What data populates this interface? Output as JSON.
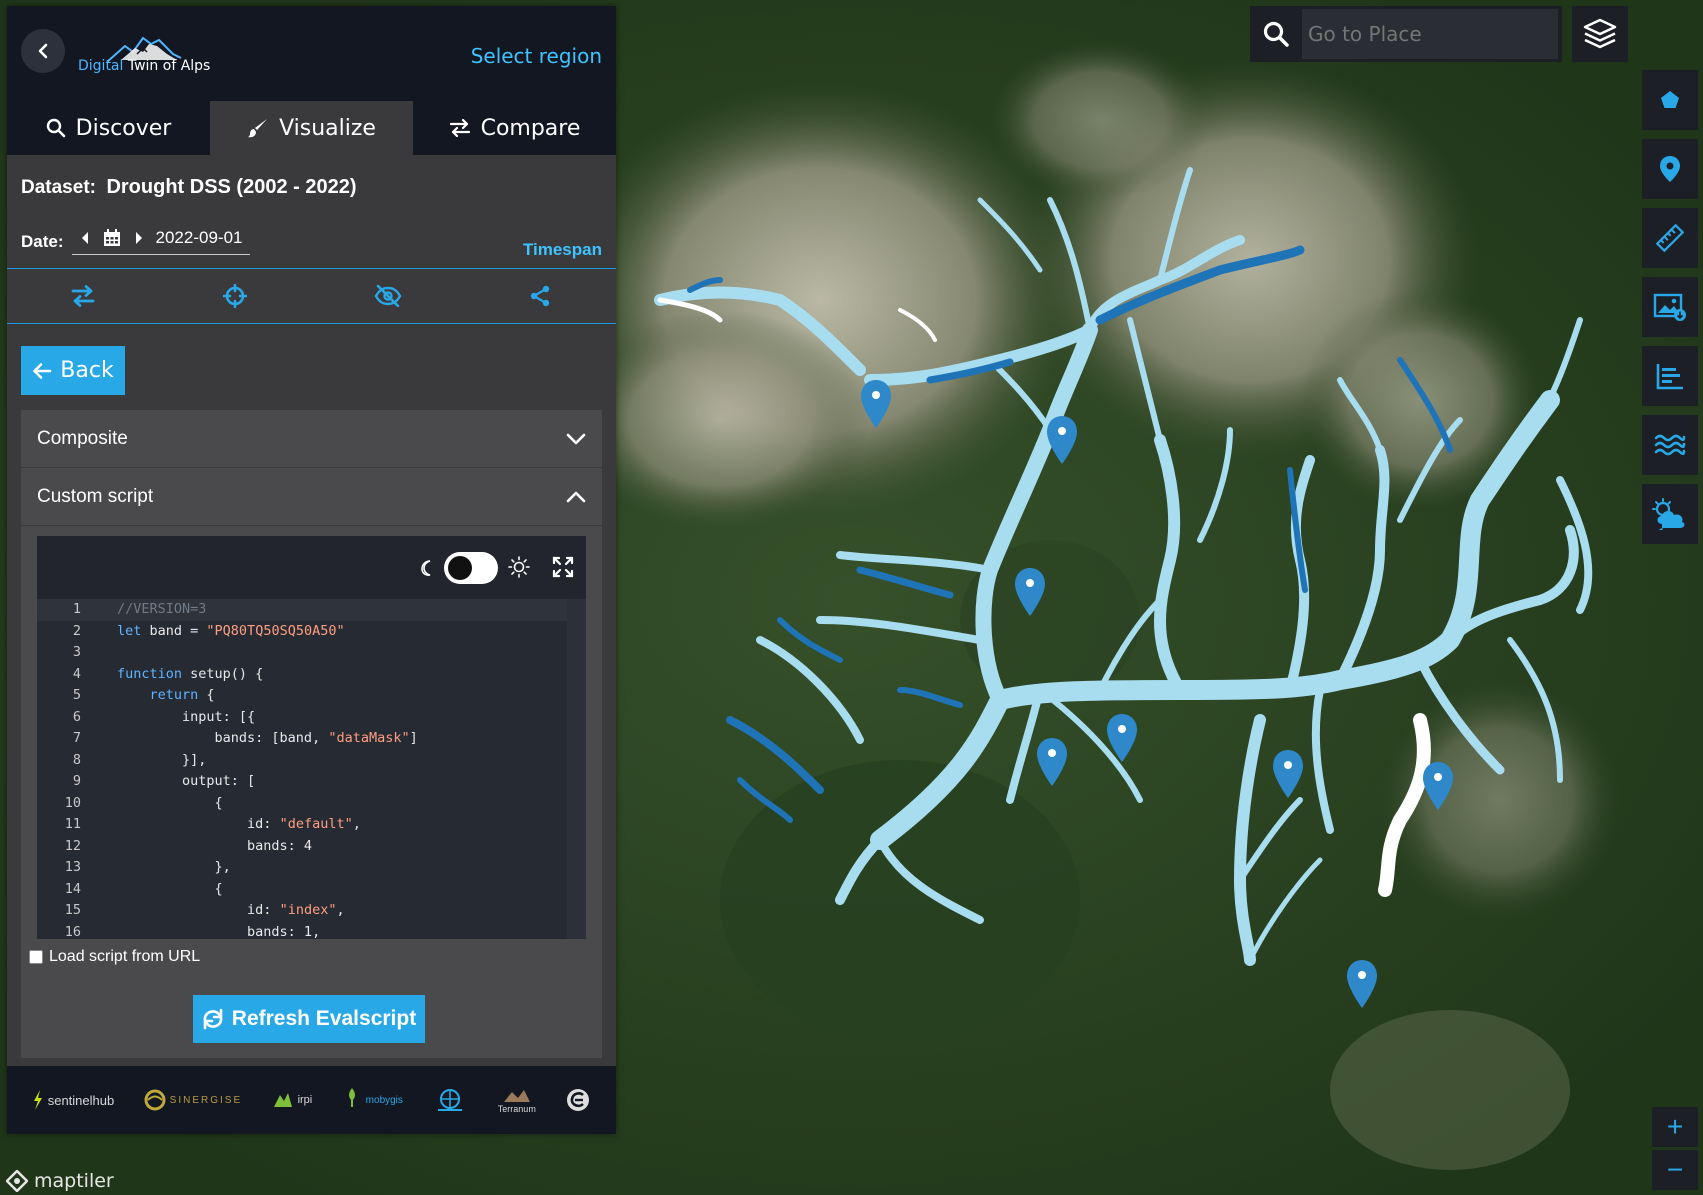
{
  "header": {
    "back_icon": "chevron-left-icon",
    "logo_brand_highlight": "Digital",
    "logo_brand_rest": " Twin of Alps",
    "select_region": "Select region"
  },
  "tabs": [
    {
      "label": "Discover",
      "icon": "search-icon",
      "active": false
    },
    {
      "label": "Visualize",
      "icon": "brush-icon",
      "active": true
    },
    {
      "label": "Compare",
      "icon": "exchange-icon",
      "active": false
    }
  ],
  "dataset": {
    "label": "Dataset:",
    "value": "Drought DSS (2002 - 2022)"
  },
  "date": {
    "label": "Date:",
    "value": "2022-09-01",
    "timespan": "Timespan"
  },
  "action_icons": [
    "swap-icon",
    "crosshair-icon",
    "eye-slash-icon",
    "share-icon"
  ],
  "back_button": "Back",
  "accordion": {
    "composite": "Composite",
    "custom_script": "Custom script"
  },
  "editor": {
    "theme_dark": true,
    "lines": [
      "//VERSION=3",
      "let band = \"PQ80TQ50SQ50A50\"",
      "",
      "function setup() {",
      "    return {",
      "        input: [{",
      "            bands: [band, \"dataMask\"]",
      "        }],",
      "        output: [",
      "            {",
      "                id: \"default\",",
      "                bands: 4",
      "            },",
      "            {",
      "                id: \"index\",",
      "                bands: 1,"
    ]
  },
  "load_script_url": "Load script from URL",
  "refresh_button": "Refresh Evalscript",
  "partners": [
    "sentinelhub",
    "SINERGISE",
    "irpi",
    "mobygis",
    "",
    "Terranum",
    ""
  ],
  "search": {
    "placeholder": "Go to Place"
  },
  "map_tools": [
    "polygon-icon",
    "marker-icon",
    "ruler-icon",
    "image-download-icon",
    "chart-icon",
    "water-icon",
    "weather-icon"
  ],
  "zoom": {
    "in": "+",
    "out": "−"
  },
  "attribution": "maptiler",
  "colors": {
    "accent": "#29a8e8",
    "link": "#3ec3ff",
    "river_light": "#a8dcef",
    "river_dark": "#1f73b7",
    "panel_dark": "#131722"
  }
}
